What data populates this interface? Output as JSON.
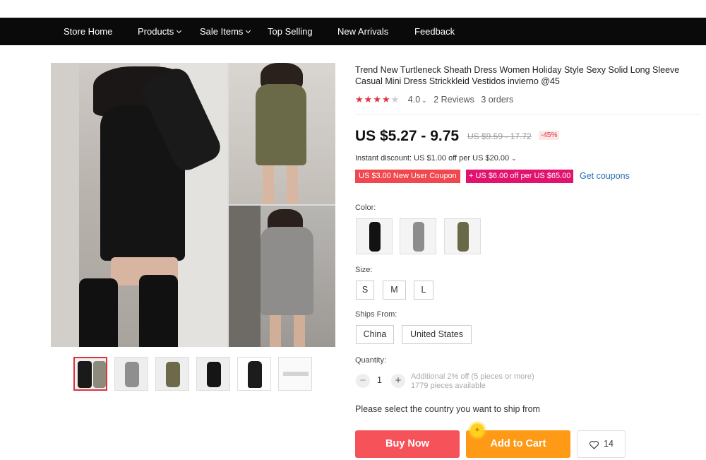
{
  "nav": {
    "items": [
      {
        "label": "Store Home"
      },
      {
        "label": "Products",
        "has_dropdown": true
      },
      {
        "label": "Sale Items",
        "has_dropdown": true
      },
      {
        "label": "Top Selling"
      },
      {
        "label": "New Arrivals"
      },
      {
        "label": "Feedback"
      }
    ]
  },
  "product": {
    "title": "Trend New Turtleneck Sheath Dress Women Holiday Style Sexy Solid Long Sleeve Casual Mini Dress Strickkleid Vestidos invierno @45",
    "rating_value": "4.0",
    "rating_stars": 4,
    "reviews": "2 Reviews",
    "orders": "3 orders",
    "price": "US $5.27 - 9.75",
    "old_price": "US $9.59 - 17.72",
    "discount": "-45%",
    "instant_discount": "Instant discount: US $1.00 off per US $20.00",
    "coupon_new_user": "US $3.00 New User Coupon",
    "coupon_store": "+ US $6.00 off per US $65.00",
    "get_coupons": "Get coupons",
    "color_label": "Color:",
    "colors": [
      {
        "name": "black"
      },
      {
        "name": "gray"
      },
      {
        "name": "army green"
      }
    ],
    "size_label": "Size:",
    "sizes": [
      "S",
      "M",
      "L"
    ],
    "ships_from_label": "Ships From:",
    "ships_from": [
      "China",
      "United States"
    ],
    "quantity_label": "Quantity:",
    "quantity": "1",
    "quantity_note_1": "Additional 2% off (5 pieces or more)",
    "quantity_note_2": "1779 pieces available",
    "ship_message": "Please select the country you want to ship from",
    "buy_now": "Buy Now",
    "add_to_cart": "Add to Cart",
    "wishlist_count": "14"
  },
  "colors": {
    "nav_bg": "#0a0a0a",
    "accent_red": "#f6525a",
    "cart_orange": "#ff9a17",
    "coupon_pink": "#e2136e",
    "link_blue": "#2a6fb5"
  }
}
